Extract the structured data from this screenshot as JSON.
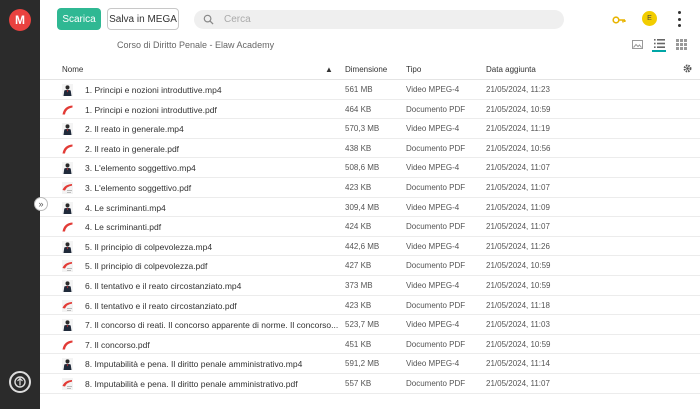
{
  "sidebar": {
    "logo": "M",
    "logo_icon": "mega-logo-icon",
    "bottom_icon": "transfer-manager-icon"
  },
  "toolbar": {
    "download_label": "Scarica",
    "save_label": "Salva in MEGA",
    "search_placeholder": "Cerca",
    "avatar_initial": "E"
  },
  "breadcrumb": "Corso di Diritto Penale - Elaw Academy",
  "colors": {
    "primary": "#2fb893",
    "brand": "#e9423f",
    "avatar": "#f2cd00",
    "accent": "#00a6a6"
  },
  "columns": {
    "name": "Nome",
    "size": "Dimensione",
    "type": "Tipo",
    "date": "Data aggiunta"
  },
  "files": [
    {
      "name": "1. Principi e nozioni introduttive.mp4",
      "size": "561 MB",
      "type": "Video MPEG-4",
      "date": "21/05/2024, 11:23",
      "kind": "video"
    },
    {
      "name": "1. Principi e nozioni introduttive.pdf",
      "size": "464 KB",
      "type": "Documento PDF",
      "date": "21/05/2024, 10:59",
      "kind": "pdf"
    },
    {
      "name": "2. Il reato in generale.mp4",
      "size": "570,3 MB",
      "type": "Video MPEG-4",
      "date": "21/05/2024, 11:19",
      "kind": "video"
    },
    {
      "name": "2. Il reato in generale.pdf",
      "size": "438 KB",
      "type": "Documento PDF",
      "date": "21/05/2024, 10:56",
      "kind": "pdf"
    },
    {
      "name": "3. L'elemento soggettivo.mp4",
      "size": "508,6 MB",
      "type": "Video MPEG-4",
      "date": "21/05/2024, 11:07",
      "kind": "video"
    },
    {
      "name": "3. L'elemento soggettivo.pdf",
      "size": "423 KB",
      "type": "Documento PDF",
      "date": "21/05/2024, 11:07",
      "kind": "pdfthumb"
    },
    {
      "name": "4. Le scriminanti.mp4",
      "size": "309,4 MB",
      "type": "Video MPEG-4",
      "date": "21/05/2024, 11:09",
      "kind": "video"
    },
    {
      "name": "4. Le scriminanti.pdf",
      "size": "424 KB",
      "type": "Documento PDF",
      "date": "21/05/2024, 11:07",
      "kind": "pdf"
    },
    {
      "name": "5. Il principio di colpevolezza.mp4",
      "size": "442,6 MB",
      "type": "Video MPEG-4",
      "date": "21/05/2024, 11:26",
      "kind": "video"
    },
    {
      "name": "5. Il principio di colpevolezza.pdf",
      "size": "427 KB",
      "type": "Documento PDF",
      "date": "21/05/2024, 10:59",
      "kind": "pdfthumb"
    },
    {
      "name": "6. Il tentativo e il reato circostanziato.mp4",
      "size": "373 MB",
      "type": "Video MPEG-4",
      "date": "21/05/2024, 10:59",
      "kind": "video"
    },
    {
      "name": "6. Il tentativo e il reato circostanziato.pdf",
      "size": "423 KB",
      "type": "Documento PDF",
      "date": "21/05/2024, 11:18",
      "kind": "pdfthumb"
    },
    {
      "name": "7. Il concorso di reati. Il concorso apparente di norme. Il concorso...",
      "size": "523,7 MB",
      "type": "Video MPEG-4",
      "date": "21/05/2024, 11:03",
      "kind": "video"
    },
    {
      "name": "7. Il concorso.pdf",
      "size": "451 KB",
      "type": "Documento PDF",
      "date": "21/05/2024, 10:59",
      "kind": "pdf"
    },
    {
      "name": "8. Imputabilità e pena. Il diritto penale amministrativo.mp4",
      "size": "591,2 MB",
      "type": "Video MPEG-4",
      "date": "21/05/2024, 11:14",
      "kind": "video"
    },
    {
      "name": "8. Imputabilità e pena. Il diritto penale amministrativo.pdf",
      "size": "557 KB",
      "type": "Documento PDF",
      "date": "21/05/2024, 11:07",
      "kind": "pdfthumb"
    }
  ]
}
